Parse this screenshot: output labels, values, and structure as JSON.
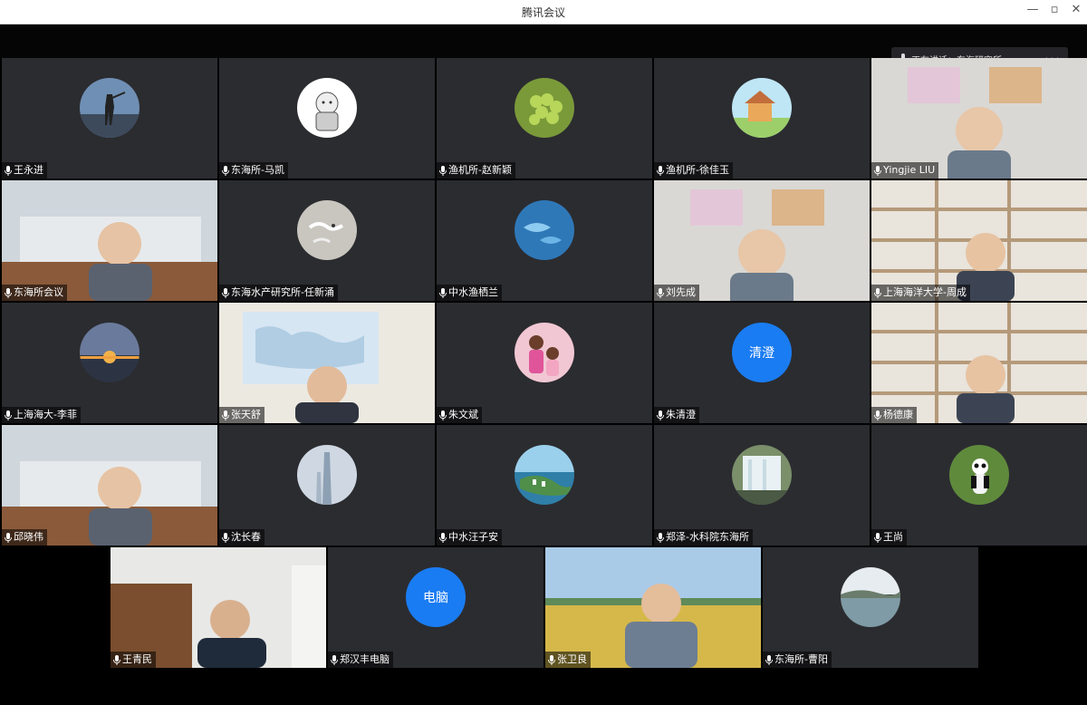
{
  "window": {
    "title": "腾讯会议",
    "minimize": "—",
    "restore": "▫",
    "close": "✕"
  },
  "speaking_indicator": {
    "text": "正在讲话：东海研究所"
  },
  "participants": [
    {
      "name": "王永进",
      "avatar": "photo"
    },
    {
      "name": "东海所-马凯",
      "avatar": "cartoon"
    },
    {
      "name": "渔机所-赵新颖",
      "avatar": "grapes"
    },
    {
      "name": "渔机所-徐佳玉",
      "avatar": "cartoon-house"
    },
    {
      "name": "Yingjie LIU",
      "avatar": "camera"
    },
    {
      "name": "东海所会议",
      "avatar": "camera-room"
    },
    {
      "name": "东海水产研究所-任新涌",
      "avatar": "birds"
    },
    {
      "name": "中水渔栖兰",
      "avatar": "fish"
    },
    {
      "name": "刘先成",
      "avatar": "camera"
    },
    {
      "name": "上海海洋大学-周成",
      "avatar": "camera-shelves"
    },
    {
      "name": "上海海大-李菲",
      "avatar": "sunset"
    },
    {
      "name": "张天舒",
      "avatar": "camera-map"
    },
    {
      "name": "朱文斌",
      "avatar": "family"
    },
    {
      "name": "朱清澄",
      "avatar": "initials",
      "initials": "清澄"
    },
    {
      "name": "杨德康",
      "avatar": "camera-shelves"
    },
    {
      "name": "邱晓伟",
      "avatar": "camera-room"
    },
    {
      "name": "沈长春",
      "avatar": "tower"
    },
    {
      "name": "中水汪子安",
      "avatar": "harbor"
    },
    {
      "name": "郑泽-水科院东海所",
      "avatar": "waterfall"
    },
    {
      "name": "王尚",
      "avatar": "panda"
    },
    {
      "name": "王青民",
      "avatar": "camera-office"
    },
    {
      "name": "郑汉丰电脑",
      "avatar": "initials",
      "initials": "电脑"
    },
    {
      "name": "张卫良",
      "avatar": "camera-field"
    },
    {
      "name": "东海所-曹阳",
      "avatar": "lake"
    }
  ]
}
